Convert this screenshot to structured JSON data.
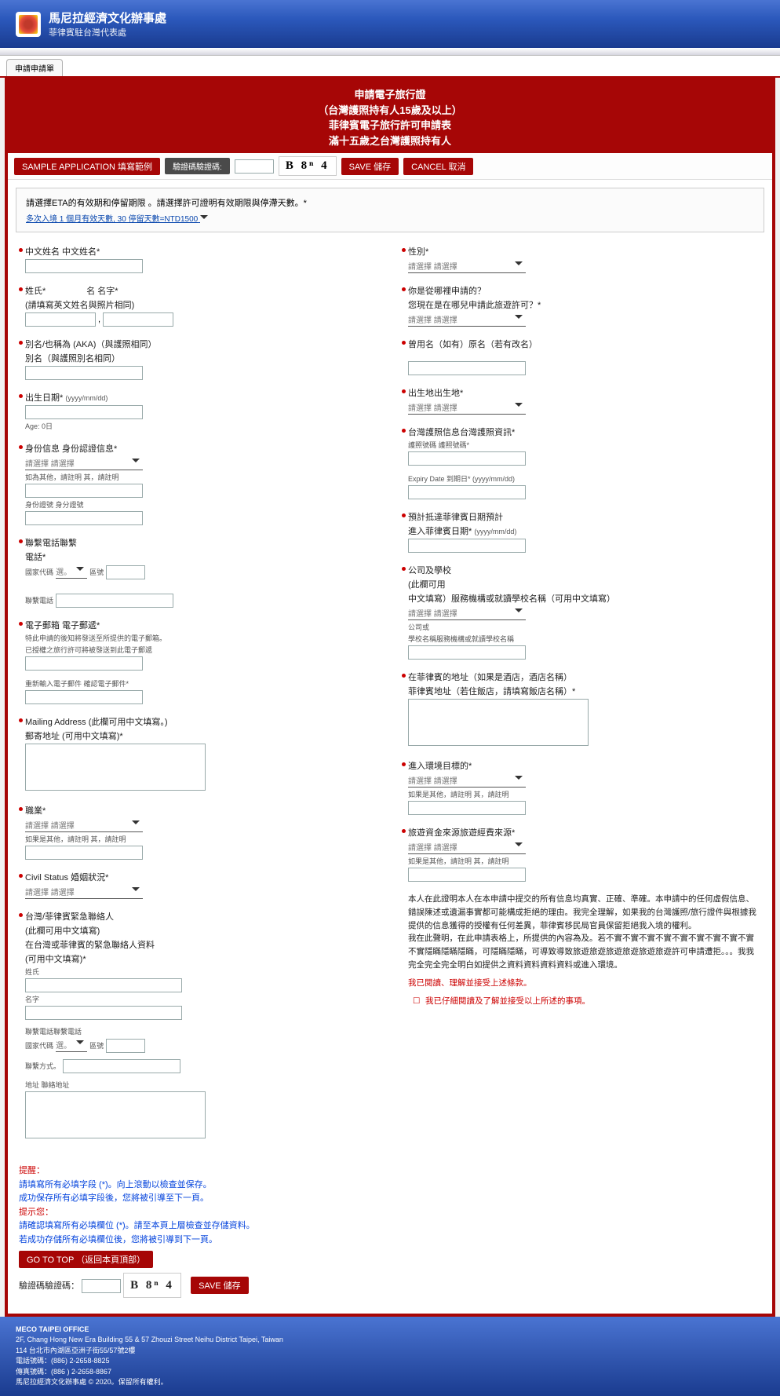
{
  "header": {
    "title": "馬尼拉經濟文化辦事處",
    "subtitle": "菲律賓駐台灣代表處"
  },
  "tab": "申請申請單",
  "title_lines": [
    "申請電子旅行證",
    "（台灣護照持有人15歲及以上）",
    "菲律賓電子旅行許可申請表",
    "滿十五歲之台灣護照持有人"
  ],
  "toolbar": {
    "sample": "SAMPLE APPLICATION 填寫範例",
    "captcha_label": "驗證碼驗證碼:",
    "captcha": "B 8ⁿ 4",
    "save": "SAVE 儲存",
    "cancel": "CANCEL 取消"
  },
  "notice": {
    "main": "請選擇ETA的有效期和停留期限 。請選擇許可證明有效期限與停滯天數。*",
    "link": "多次入境 1 個月有效天數, 30 停留天數=NTD1500"
  },
  "left": {
    "chinese_name": "中文姓名 中文姓名*",
    "surname": "姓氏*",
    "given": "名 名字*",
    "surname_hint": "(請填寫英文姓名與照片相同)",
    "aka": "別名/也稱為 (AKA)（與護照相同）",
    "aka2": "別名（與護照別名相同）",
    "dob": "出生日期*",
    "dob_fmt": "(yyyy/mm/dd)",
    "age": "Age: 0日",
    "identity": "身份信息 身份認證信息*",
    "id_sel": "請選擇 請選擇",
    "id_other": "如為其他，請註明 其，請註明",
    "id_num": "身份證號 身分證號",
    "contact": "聯繫電話聯繫",
    "phone": "電話*",
    "country_code": "國家代碼",
    "area": "區號",
    "contact_phone": "聯繫電話",
    "email": "電子郵箱 電子郵遞*",
    "email_hint1": "特此申請的後知將發送至所提供的電子郵箱。",
    "email_hint2": "已授權之旅行許可將被發送到此電子郵遞",
    "email_confirm": "重新輸入電子郵件 確認電子郵件*",
    "mailing": "Mailing Address (此欄可用中文填寫。)",
    "mailing2": "郵寄地址 (可用中文填寫)*",
    "occupation": "職業*",
    "occ_sel": "請選擇 請選擇",
    "occ_other": "如果是其他，請註明 其，請註明",
    "civil": "Civil Status 婚姻狀況*",
    "civil_sel": "請選擇 請選擇",
    "emergency": "台灣/菲律賓緊急聯絡人",
    "emerg2": "(此欄可用中文填寫)",
    "emerg3": "在台灣或菲律賓的緊急聯絡人資料",
    "emerg4": "(可用中文填寫)*",
    "em_surname": "姓氏",
    "em_name": "名字",
    "em_phone": "聯繫電話聯繫電話",
    "em_cc": "國家代碼",
    "em_area": "區號",
    "em_method": "聯繫方式。",
    "em_addr": "地址 聯絡地址"
  },
  "right": {
    "sex": "性別*",
    "sex_sel": "請選擇 請選擇",
    "where": "你是從哪裡申請的？",
    "where2": "您現在是在哪兒申請此旅遊許可？*",
    "where_sel": "請選擇 請選擇",
    "former": "曾用名（如有）原名（若有改名）",
    "birthplace": "出生地出生地*",
    "bp_sel": "請選擇 請選擇",
    "passport": "台灣護照信息台灣護照資訊*",
    "pp_num": "護照號碼 護照號碼*",
    "pp_exp": "Expiry Date 到期日* (yyyy/mm/dd)",
    "arrival": "預計抵達菲律賓日期預計",
    "arrival2": "進入菲律賓日期*",
    "arr_fmt": "(yyyy/mm/dd)",
    "company": "公司及學校",
    "company2": "(此欄可用",
    "company3": "中文填寫）服務機構或就讀學校名稱（可用中文填寫）",
    "comp_sel": "請選擇 請選擇",
    "comp_or": "公司或",
    "comp_hint": "學校名稱服務機構或就讀學校名稱",
    "ph_addr": "在菲律賓的地址（如果是酒店，酒店名稱）",
    "ph_addr2": "菲律賓地址（若住飯店，請填寫飯店名稱）*",
    "purpose": "進入環境目標的*",
    "purp_sel": "請選擇 請選擇",
    "purp_other": "如果是其他，請註明 其，請註明",
    "fund": "旅遊資金來源旅遊經費來源*",
    "fund_sel": "請選擇 請選擇",
    "fund_other": "如果是其他，請註明 其，請註明",
    "declaration": "本人在此證明本人在本申請中提交的所有信息均真實、正確、準確。本申請中的任何虛假信息、錯誤陳述或遺漏事實都可能構成拒絕的理由。我完全理解，如果我的台灣護照/旅行證件與根據我提供的信息獲得的授權有任何差異，菲律賓移民局官員保留拒絕我入境的權利。",
    "declaration2": "我在此聲明，在此申請表格上，所提供的內容為及。若不實不實不實不實不實不實不實不實不實不實隱瞞隱瞞隱瞞，可隱瞞隱瞞，可導致導致旅遊旅遊旅遊旅遊旅遊旅遊許可申請遭拒。。。我我完全完全完全明白如提供之資料資料資料資料或進入環境。",
    "decl_red1": "我已閱讀、理解並接受上述條款。",
    "decl_red2": "我已仔細閱讀及了解並接受以上所述的事項。"
  },
  "bottom": {
    "hdr1": "提醒：",
    "l1": "請填寫所有必填字段 (*)。向上滾動以檢查並保存。",
    "l2": "成功保存所有必填字段後，您將被引導至下一頁。",
    "hdr2": "提示您：",
    "l3": "請確認填寫所有必填欄位 (*)。請至本頁上層檢查並存儲資料。",
    "l4": "若成功存儲所有必填欄位後，您將被引導到下一頁。",
    "gotop": "GO TO TOP （返回本頁頂部）",
    "cap_label": "驗證碼驗證碼：",
    "captcha": "B 8ⁿ 4",
    "save": "SAVE 儲存"
  },
  "footer": {
    "l1": "MECO TAIPEI OFFICE",
    "l2": "2F, Chang Hong New Era Building 55 & 57 Zhouzi Street Neihu District Taipei, Taiwan",
    "l3": "114 台北市內湖區亞洲子街55/57號2樓",
    "l4": "電話號碼：(886) 2-2658-8825",
    "l5": "傳真號碼：(886 ) 2-2658-8867",
    "l6": "馬尼拉經濟文化辦事處 © 2020。保留所有權利。"
  }
}
